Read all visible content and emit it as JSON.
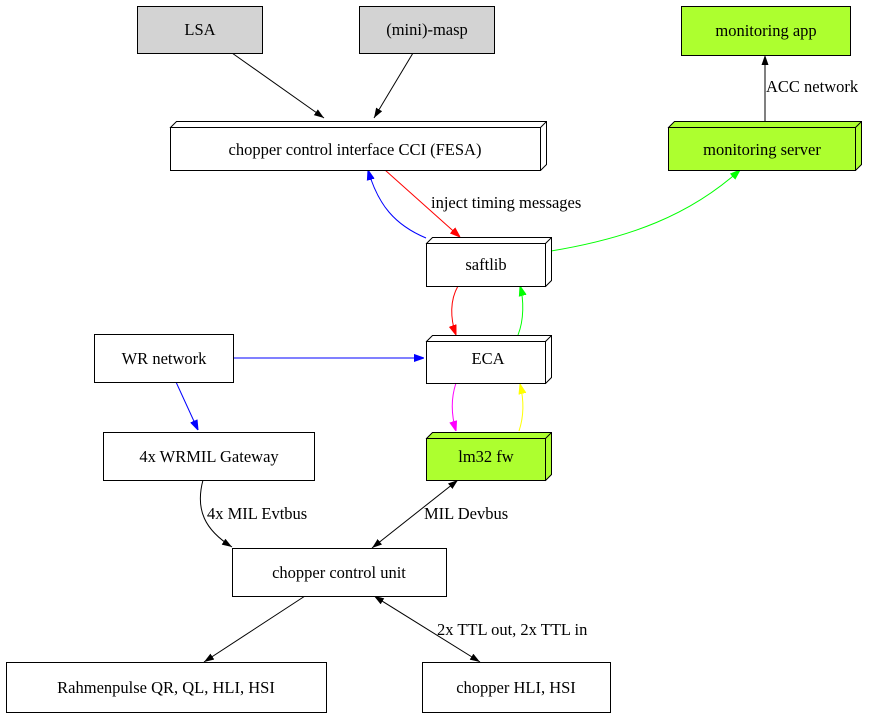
{
  "nodes": {
    "lsa": "LSA",
    "masp": "(mini)-masp",
    "monitoring_app": "monitoring app",
    "cci": "chopper control interface CCI (FESA)",
    "monitoring_server": "monitoring server",
    "saftlib": "saftlib",
    "eca": "ECA",
    "wr_network": "WR network",
    "wrmil_gateway": "4x WRMIL Gateway",
    "lm32_fw": "lm32 fw",
    "chopper_control_unit": "chopper control unit",
    "rahmenpulse": "Rahmenpulse QR, QL, HLI, HSI",
    "chopper_hli_hsi": "chopper HLI, HSI"
  },
  "edge_labels": {
    "acc_network": "ACC network",
    "inject_timing": "inject timing messages",
    "mil_evtbus": "4x MIL Evtbus",
    "mil_devbus": "MIL Devbus",
    "ttl": "2x TTL out, 2x TTL in"
  },
  "colors": {
    "gray_node": "#d3d3d3",
    "green_node": "#adff2f",
    "red": "#ff0000",
    "blue": "#0000ff",
    "green": "#00ff00",
    "magenta": "#ff00ff",
    "yellow": "#ffff00"
  }
}
